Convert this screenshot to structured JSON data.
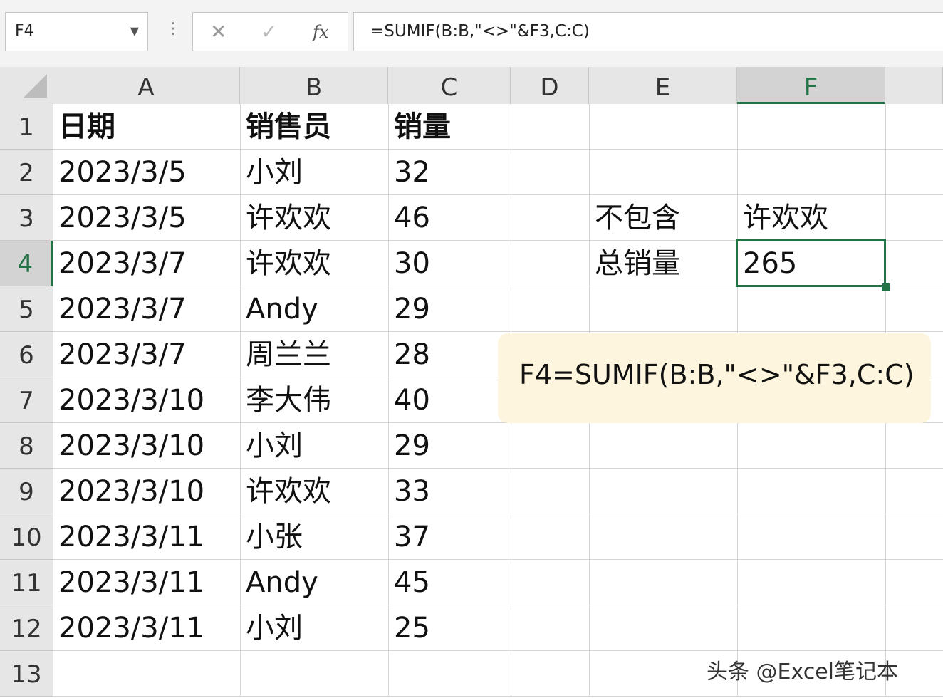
{
  "formula_bar": {
    "name_box": "F4",
    "separator": "⋮",
    "cancel_icon": "✕",
    "enter_icon": "✓",
    "fx_label": "fx",
    "formula": "=SUMIF(B:B,\"<>\"&F3,C:C)"
  },
  "columns": [
    "A",
    "B",
    "C",
    "D",
    "E",
    "F"
  ],
  "rows": [
    "1",
    "2",
    "3",
    "4",
    "5",
    "6",
    "7",
    "8",
    "9",
    "10",
    "11",
    "12",
    "13"
  ],
  "headers": {
    "date": "日期",
    "salesperson": "销售员",
    "quantity": "销量"
  },
  "data_rows": [
    {
      "date": "2023/3/5",
      "salesperson": "小刘",
      "quantity": "32"
    },
    {
      "date": "2023/3/5",
      "salesperson": "许欢欢",
      "quantity": "46"
    },
    {
      "date": "2023/3/7",
      "salesperson": "许欢欢",
      "quantity": "30"
    },
    {
      "date": "2023/3/7",
      "salesperson": "Andy",
      "quantity": "29"
    },
    {
      "date": "2023/3/7",
      "salesperson": "周兰兰",
      "quantity": "28"
    },
    {
      "date": "2023/3/10",
      "salesperson": "李大伟",
      "quantity": "40"
    },
    {
      "date": "2023/3/10",
      "salesperson": "小刘",
      "quantity": "29"
    },
    {
      "date": "2023/3/10",
      "salesperson": "许欢欢",
      "quantity": "33"
    },
    {
      "date": "2023/3/11",
      "salesperson": "小张",
      "quantity": "37"
    },
    {
      "date": "2023/3/11",
      "salesperson": "Andy",
      "quantity": "45"
    },
    {
      "date": "2023/3/11",
      "salesperson": "小刘",
      "quantity": "25"
    }
  ],
  "side": {
    "e3": "不包含",
    "f3": "许欢欢",
    "e4": "总销量",
    "f4": "265"
  },
  "note": "F4=SUMIF(B:B,\"<>\"&F3,C:C)",
  "watermark": "头条 @Excel笔记本",
  "colors": {
    "accent": "#217346",
    "note_bg": "#fdf5dd",
    "header_bg": "#e6e6e6"
  }
}
